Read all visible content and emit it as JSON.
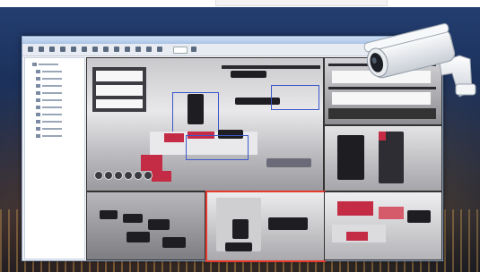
{
  "window": {
    "app_title": ""
  },
  "toolbar": {
    "buttons": [
      "tb1",
      "tb2",
      "tb3",
      "tb4",
      "tb5",
      "tb6",
      "tb7",
      "tb8",
      "tb9",
      "tb10",
      "tb11",
      "tb12",
      "tb13",
      "tb14",
      "tb15"
    ]
  },
  "sidebar": {
    "tree_items": 12
  },
  "grid": {
    "cameras": [
      "cam-a",
      "cam-b",
      "cam-c",
      "cam-d",
      "cam-e",
      "cam-f"
    ],
    "selected_camera": "cam-e"
  },
  "colors": {
    "selection": "#e53a2e",
    "detection_box": "#3b57c9",
    "accent_red": "#c42b44"
  },
  "icons": [
    "security-camera-icon",
    "ptz-control-icon"
  ]
}
